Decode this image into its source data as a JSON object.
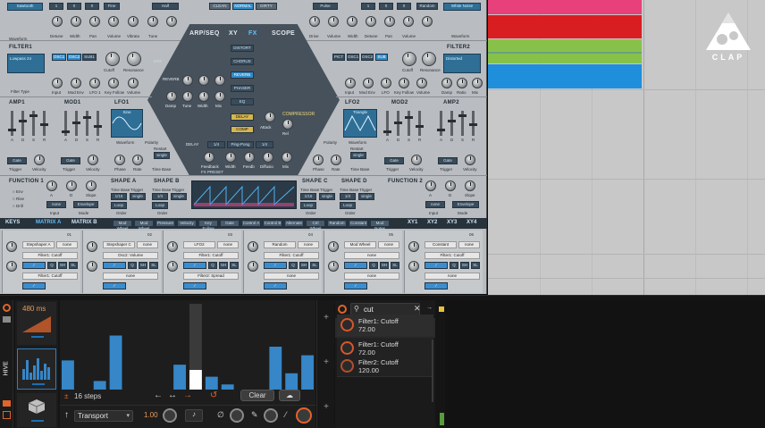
{
  "synth": {
    "osc_left": {
      "wave": "Sawtooth",
      "nums": [
        "1",
        "0",
        "0"
      ],
      "fn": "Fine",
      "semi": "Half",
      "labels": [
        "Waveform",
        "Octave",
        "Semi",
        "Detune",
        "Width",
        "Pan",
        "Volume",
        "Vibrato",
        "Tune",
        "Waveform"
      ]
    },
    "osc_right": {
      "wave": "Pulse",
      "nums": [
        "1",
        "0",
        "0"
      ],
      "sel": "Random",
      "noise": "White Noise",
      "labels": [
        "Drive",
        "Volume",
        "Width",
        "Detune",
        "Octave",
        "Semi",
        "Waveform",
        "Pan",
        "Volume"
      ]
    },
    "mode_buttons": [
      "CLEAN",
      "NORMAL",
      "DIRTY"
    ],
    "tabs": [
      "ARP/SEQ",
      "XY",
      "FX",
      "SCOPE"
    ],
    "filter1": {
      "title": "FILTER1",
      "type": "Lowpass 24",
      "routes": [
        "OSC1",
        "OSC2",
        "SUB1"
      ],
      "labels": [
        "Filter Type",
        "Input",
        "Mod Env",
        "LFO 1",
        "Key Follow",
        "Volume",
        "Cutoff",
        "Resonance"
      ]
    },
    "filter2": {
      "title": "FILTER2",
      "type": "Distorted",
      "routes": [
        "PICT",
        "OSC1",
        "OSC2",
        "SUB"
      ],
      "labels": [
        "Input",
        "Mod Env",
        "LFO",
        "Key Follow",
        "Volume",
        "Cutoff",
        "Resonance",
        "Damp",
        "Ratio",
        "Mix"
      ]
    },
    "fx": {
      "distort": "DISTORT",
      "chorus": "CHORUS",
      "reverb": "REVERB",
      "phaser": "PHASER",
      "eq": "EQ",
      "delay": "DELAY",
      "comp": "COMP",
      "compressor": "COMPRESSOR",
      "reverb_label": "REVERB",
      "delay_label": "DELAY",
      "fx_preset": "FX PRESET",
      "knobs1": [
        "Damp",
        "Tune",
        "Width",
        "Mix"
      ],
      "delay_vals": [
        "1/4",
        "Ping-Pong",
        "1/4"
      ],
      "delay_knobs": [
        "Feedback",
        "Width",
        "Feedb",
        "Diffusio",
        "Mix"
      ],
      "comp_knobs": [
        "Attack",
        "Rel"
      ],
      "lfo": "LFO"
    },
    "amp1": {
      "title": "AMP1",
      "labels": [
        "A",
        "D",
        "S",
        "R"
      ],
      "trigger": "Gate",
      "sub": [
        "Trigger",
        "Velocity"
      ]
    },
    "mod1": {
      "title": "MOD1",
      "labels": [
        "A",
        "D",
        "S",
        "R"
      ],
      "trigger": "Gate",
      "sub": [
        "Trigger",
        "Velocity"
      ]
    },
    "lfo1": {
      "title": "LFO1",
      "wave": "Sine",
      "labels": [
        "Waveform",
        "Polarity",
        "Restart",
        "Phase",
        "Rate",
        "Time Base"
      ],
      "restart": "single"
    },
    "lfo2": {
      "title": "LFO2",
      "wave": "Triangle",
      "labels": [
        "Polarity",
        "Waveform",
        "Restart",
        "Phase",
        "Rate",
        "Time Base"
      ],
      "restart": "single"
    },
    "mod2": {
      "title": "MOD2",
      "labels": [
        "A",
        "D",
        "S",
        "R"
      ],
      "trigger": "Gate",
      "sub": [
        "Trigger",
        "Velocity"
      ]
    },
    "amp2": {
      "title": "AMP2",
      "labels": [
        "A",
        "D",
        "S",
        "R"
      ],
      "trigger": "Gate",
      "sub": [
        "Trigger",
        "Velocity"
      ]
    },
    "function1": {
      "title": "FUNCTION 1",
      "opts": [
        "Env",
        "Rise",
        "Drill"
      ],
      "labels": [
        "Input",
        "Mode",
        "A",
        "D",
        "Slope"
      ],
      "input": "none",
      "mode": "Envelope"
    },
    "function2": {
      "title": "FUNCTION 2",
      "labels": [
        "Input",
        "Mode",
        "A",
        "D",
        "Slope"
      ],
      "input": "none",
      "mode": "Envelope"
    },
    "shapes": [
      {
        "title": "SHAPE A",
        "tb": "Time Base",
        "tr": "Trigger",
        "v1": "1/16",
        "v2": "single",
        "ord": "Order",
        "ordv": "Loop"
      },
      {
        "title": "SHAPE B",
        "tb": "Time Base",
        "tr": "Trigger",
        "v1": "1/4",
        "v2": "single",
        "ord": "Order",
        "ordv": "Loop"
      },
      {
        "title": "SHAPE C",
        "tb": "Time Base",
        "tr": "Trigger",
        "v1": "1/16",
        "v2": "single",
        "ord": "Order",
        "ordv": "Loop"
      },
      {
        "title": "SHAPE D",
        "tb": "Time Base",
        "tr": "Trigger",
        "v1": "1/4",
        "v2": "single",
        "ord": "Order",
        "ordv": "Loop"
      }
    ],
    "matrix_tabs": [
      "KEYS",
      "MATRIX A",
      "MATRIX B"
    ],
    "matrix_sources": [
      "Mod Wheel",
      "Mod Wheel",
      "Pressure",
      "Velocity",
      "Key Follow",
      "Gate",
      "Control A",
      "Control B",
      "Alternate",
      "Ctrl Wheel",
      "Random",
      "Constant",
      "Mod Notes"
    ],
    "xy": [
      "XY1",
      "XY2",
      "XY3",
      "XY4"
    ],
    "slots": [
      {
        "num": "01",
        "src": "Stepshaper A",
        "dst1": "Filter1: Cutoff",
        "dst2": "Filter1: Cutoff",
        "none": "none"
      },
      {
        "num": "02",
        "src": "Stepshaper C",
        "dst1": "Osc2: Volume",
        "dst2": "none",
        "none": "none"
      },
      {
        "num": "03",
        "src": "LFO2",
        "dst1": "Filter1: Cutoff",
        "dst2": "Filter2: Spread",
        "none": "none"
      },
      {
        "num": "04",
        "src": "Random",
        "dst1": "Filter1: Cutoff",
        "dst2": "none",
        "none": "none"
      },
      {
        "num": "05",
        "src": "Mod Wheel",
        "dst1": "none",
        "dst2": "none",
        "none": "none"
      },
      {
        "num": "06",
        "src": "Constant",
        "dst1": "Filter1: Cutoff",
        "dst2": "none",
        "none": "none"
      }
    ],
    "slot_btns": [
      "Q",
      "SH",
      "SL"
    ]
  },
  "logo": {
    "text": "CLAP"
  },
  "colors": {
    "clip_pink": "#e8407b",
    "clip_red": "#d91e22",
    "clip_green": "#88c14a",
    "clip_blue": "#1f8fdc",
    "accent_orange": "#e0642c",
    "bar_blue": "#3686c8"
  },
  "bottom": {
    "device_label": "HIVE",
    "timing": "480 ms",
    "steps_label": "16 steps",
    "clear_label": "Clear",
    "transport": "Transport",
    "rate": "1.00",
    "search_value": "cut",
    "targets": [
      {
        "name": "Filter1: Cutoff",
        "value": "72.00"
      },
      {
        "name": "Filter1: Cutoff",
        "value": "72.00"
      },
      {
        "name": "Filter2: Cutoff",
        "value": "120.00"
      }
    ],
    "step_values": [
      0.34,
      0.0,
      0.1,
      0.63,
      0.0,
      0.0,
      0.0,
      0.29,
      0.0,
      0.15,
      0.06,
      0.0,
      0.0,
      0.5,
      0.19,
      0.4
    ]
  }
}
